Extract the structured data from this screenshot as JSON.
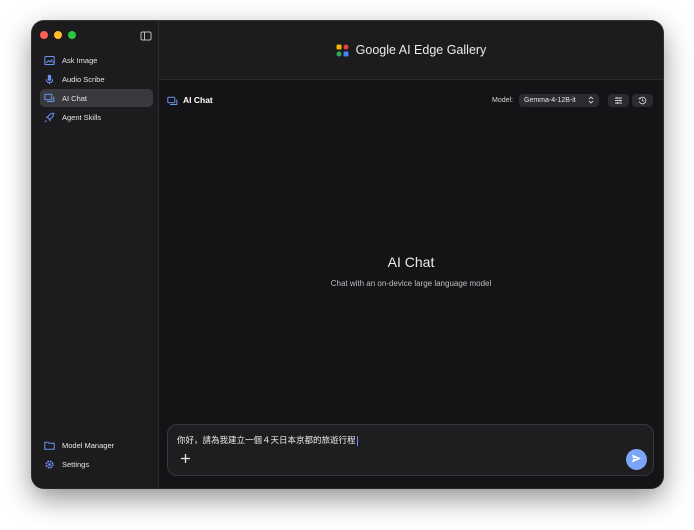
{
  "sidebar": {
    "items": [
      {
        "label": "Ask Image",
        "icon": "image-icon"
      },
      {
        "label": "Audio Scribe",
        "icon": "microphone-icon"
      },
      {
        "label": "AI Chat",
        "icon": "chat-icon",
        "active": true
      },
      {
        "label": "Agent Skills",
        "icon": "rocket-icon"
      }
    ],
    "bottom_items": [
      {
        "label": "Model Manager",
        "icon": "folder-icon"
      },
      {
        "label": "Settings",
        "icon": "gear-icon"
      }
    ]
  },
  "header": {
    "title": "Google AI Edge Gallery"
  },
  "toolbar": {
    "title": "AI Chat",
    "model_label": "Model:",
    "model_value": "Gemma-4-12B-it"
  },
  "empty_state": {
    "title": "AI Chat",
    "subtitle": "Chat with an on-device large language model"
  },
  "composer": {
    "value": "你好，請為我建立一個４天日本京都的旅遊行程"
  },
  "colors": {
    "accent": "#7aa5f8",
    "icon_blue": "#6d94f2",
    "window_bg": "#161618",
    "sidebar_bg": "#1c1c1e",
    "active_item_bg": "#3a3a3e"
  }
}
